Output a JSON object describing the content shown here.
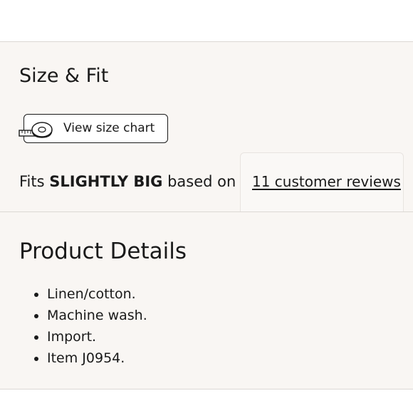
{
  "size_fit": {
    "heading": "Size & Fit",
    "size_chart_button_label": "View size chart",
    "fit_prefix": "Fits",
    "fit_value": "SLIGHTLY BIG",
    "fit_suffix": "based on",
    "reviews_link_label": "11 customer reviews"
  },
  "product_details": {
    "heading": "Product Details",
    "items": [
      "Linen/cotton.",
      "Machine wash.",
      "Import.",
      "Item J0954."
    ]
  },
  "icons": {
    "size_chart": "measuring-tape-icon",
    "bullet": "bullet-dot-icon"
  },
  "colors": {
    "section_background": "#f9f6f3",
    "text": "#1a1a1a",
    "divider": "#dcd8d4"
  }
}
